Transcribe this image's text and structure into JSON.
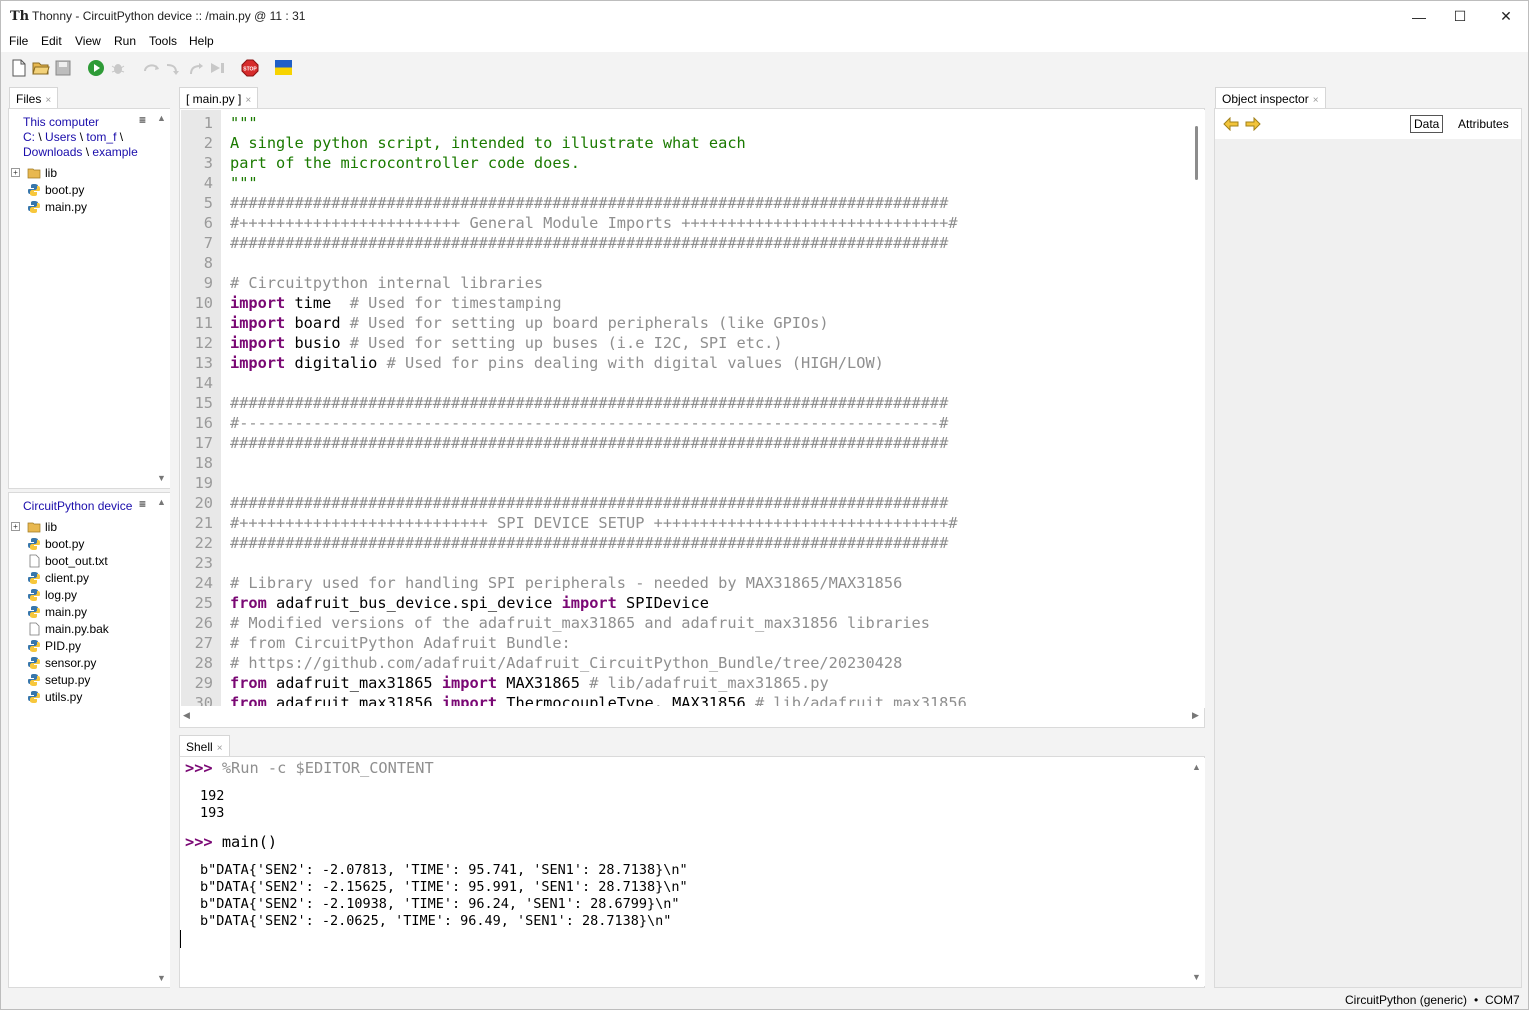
{
  "window": {
    "title": "Thonny  -  CircuitPython device :: /main.py  @  11 : 31",
    "logo": "Th",
    "controls": {
      "minimize": "—",
      "maximize": "☐",
      "close": "✕"
    }
  },
  "menu": [
    "File",
    "Edit",
    "View",
    "Run",
    "Tools",
    "Help"
  ],
  "toolbar": {
    "icons": [
      "new-file-icon",
      "open-file-icon",
      "save-icon",
      "run-icon",
      "debug-icon",
      "step-over-icon",
      "step-into-icon",
      "step-out-icon",
      "resume-icon",
      "stop-icon",
      "ukraine-flag-icon"
    ],
    "stop_label": "STOP",
    "colors": {
      "run": "#2e9b37",
      "stop": "#d62b2b",
      "flag_blue": "#1f5fc7",
      "flag_yellow": "#f7d300"
    }
  },
  "files_panel": {
    "tab_label": "Files",
    "computer": {
      "path_line1": [
        "This computer"
      ],
      "path_line2": [
        "C:",
        "Users",
        "tom_f"
      ],
      "path_line3": [
        "Downloads",
        "example"
      ],
      "trailing_sep": "\\",
      "items": [
        {
          "name": "lib",
          "type": "folder",
          "expandable": true
        },
        {
          "name": "boot.py",
          "type": "python"
        },
        {
          "name": "main.py",
          "type": "python"
        }
      ]
    },
    "device": {
      "title": "CircuitPython device",
      "items": [
        {
          "name": "lib",
          "type": "folder",
          "expandable": true
        },
        {
          "name": "boot.py",
          "type": "python"
        },
        {
          "name": "boot_out.txt",
          "type": "text"
        },
        {
          "name": "client.py",
          "type": "python"
        },
        {
          "name": "log.py",
          "type": "python"
        },
        {
          "name": "main.py",
          "type": "python"
        },
        {
          "name": "main.py.bak",
          "type": "text"
        },
        {
          "name": "PID.py",
          "type": "python"
        },
        {
          "name": "sensor.py",
          "type": "python"
        },
        {
          "name": "setup.py",
          "type": "python"
        },
        {
          "name": "utils.py",
          "type": "python"
        }
      ]
    },
    "menu_glyph": "≡"
  },
  "editor": {
    "tab_label": "[ main.py ]",
    "lines": [
      {
        "n": "1",
        "tokens": [
          {
            "t": "\"\"\"",
            "c": "str"
          }
        ]
      },
      {
        "n": "2",
        "tokens": [
          {
            "t": "A single python script, intended to illustrate what each",
            "c": "str"
          }
        ]
      },
      {
        "n": "3",
        "tokens": [
          {
            "t": "part of the microcontroller code does.",
            "c": "str"
          }
        ]
      },
      {
        "n": "4",
        "tokens": [
          {
            "t": "\"\"\"",
            "c": "str"
          }
        ]
      },
      {
        "n": "5",
        "tokens": [
          {
            "t": "##############################################################################",
            "c": "cm"
          }
        ]
      },
      {
        "n": "6",
        "tokens": [
          {
            "t": "#++++++++++++++++++++++++ General Module Imports +++++++++++++++++++++++++++++#",
            "c": "cm"
          }
        ]
      },
      {
        "n": "7",
        "tokens": [
          {
            "t": "##############################################################################",
            "c": "cm"
          }
        ]
      },
      {
        "n": "8",
        "tokens": []
      },
      {
        "n": "9",
        "tokens": [
          {
            "t": "# Circuitpython internal libraries",
            "c": "cm"
          }
        ]
      },
      {
        "n": "10",
        "tokens": [
          {
            "t": "import",
            "c": "kw"
          },
          {
            "t": " time  ",
            "c": ""
          },
          {
            "t": "# Used for timestamping",
            "c": "cm"
          }
        ]
      },
      {
        "n": "11",
        "tokens": [
          {
            "t": "import",
            "c": "kw"
          },
          {
            "t": " board ",
            "c": ""
          },
          {
            "t": "# Used for setting up board peripherals (like GPIOs)",
            "c": "cm"
          }
        ]
      },
      {
        "n": "12",
        "tokens": [
          {
            "t": "import",
            "c": "kw"
          },
          {
            "t": " busio ",
            "c": ""
          },
          {
            "t": "# Used for setting up buses (i.e I2C, SPI etc.)",
            "c": "cm"
          }
        ]
      },
      {
        "n": "13",
        "tokens": [
          {
            "t": "import",
            "c": "kw"
          },
          {
            "t": " digitalio ",
            "c": ""
          },
          {
            "t": "# Used for pins dealing with digital values (HIGH/LOW)",
            "c": "cm"
          }
        ]
      },
      {
        "n": "14",
        "tokens": []
      },
      {
        "n": "15",
        "tokens": [
          {
            "t": "##############################################################################",
            "c": "cm"
          }
        ]
      },
      {
        "n": "16",
        "tokens": [
          {
            "t": "#----------------------------------------------------------------------------#",
            "c": "cm"
          }
        ]
      },
      {
        "n": "17",
        "tokens": [
          {
            "t": "##############################################################################",
            "c": "cm"
          }
        ]
      },
      {
        "n": "18",
        "tokens": []
      },
      {
        "n": "19",
        "tokens": []
      },
      {
        "n": "20",
        "tokens": [
          {
            "t": "##############################################################################",
            "c": "cm"
          }
        ]
      },
      {
        "n": "21",
        "tokens": [
          {
            "t": "#+++++++++++++++++++++++++++ SPI DEVICE SETUP ++++++++++++++++++++++++++++++++#",
            "c": "cm"
          }
        ]
      },
      {
        "n": "22",
        "tokens": [
          {
            "t": "##############################################################################",
            "c": "cm"
          }
        ]
      },
      {
        "n": "23",
        "tokens": []
      },
      {
        "n": "24",
        "tokens": [
          {
            "t": "# Library used for handling SPI peripherals - needed by MAX31865/MAX31856",
            "c": "cm"
          }
        ]
      },
      {
        "n": "25",
        "tokens": [
          {
            "t": "from",
            "c": "kw"
          },
          {
            "t": " adafruit_bus_device.spi_device ",
            "c": ""
          },
          {
            "t": "import",
            "c": "kw"
          },
          {
            "t": " SPIDevice",
            "c": ""
          }
        ]
      },
      {
        "n": "26",
        "tokens": [
          {
            "t": "# Modified versions of the adafruit_max31865 and adafruit_max31856 libraries",
            "c": "cm"
          }
        ]
      },
      {
        "n": "27",
        "tokens": [
          {
            "t": "# from CircuitPython Adafruit Bundle:",
            "c": "cm"
          }
        ]
      },
      {
        "n": "28",
        "tokens": [
          {
            "t": "# https://github.com/adafruit/Adafruit_CircuitPython_Bundle/tree/20230428",
            "c": "cm"
          }
        ]
      },
      {
        "n": "29",
        "tokens": [
          {
            "t": "from",
            "c": "kw"
          },
          {
            "t": " adafruit_max31865 ",
            "c": ""
          },
          {
            "t": "import",
            "c": "kw"
          },
          {
            "t": " MAX31865 ",
            "c": ""
          },
          {
            "t": "# lib/adafruit_max31865.py",
            "c": "cm"
          }
        ]
      },
      {
        "n": "30",
        "tokens": [
          {
            "t": "from",
            "c": "kw"
          },
          {
            "t": " adafruit_max31856 ",
            "c": ""
          },
          {
            "t": "import",
            "c": "kw"
          },
          {
            "t": " ThermocoupleType, MAX31856 ",
            "c": ""
          },
          {
            "t": "# lib/adafruit_max31856",
            "c": "cm"
          }
        ]
      }
    ]
  },
  "shell": {
    "tab_label": "Shell",
    "prompt": ">>>",
    "cmd1": " %Run -c $EDITOR_CONTENT",
    "out1": [
      "192",
      "193"
    ],
    "cmd2": " main()",
    "out2": [
      "b\"DATA{'SEN2': -2.07813, 'TIME': 95.741, 'SEN1': 28.7138}\\n\"",
      "b\"DATA{'SEN2': -2.15625, 'TIME': 95.991, 'SEN1': 28.7138}\\n\"",
      "b\"DATA{'SEN2': -2.10938, 'TIME': 96.24, 'SEN1': 28.6799}\\n\"",
      "b\"DATA{'SEN2': -2.0625, 'TIME': 96.49, 'SEN1': 28.7138}\\n\""
    ]
  },
  "object_inspector": {
    "tab_label": "Object inspector",
    "data_tab": "Data",
    "attributes_tab": "Attributes"
  },
  "tab_close_glyph": "×",
  "status": {
    "interpreter": "CircuitPython (generic)",
    "sep": "•",
    "port": "COM7"
  }
}
